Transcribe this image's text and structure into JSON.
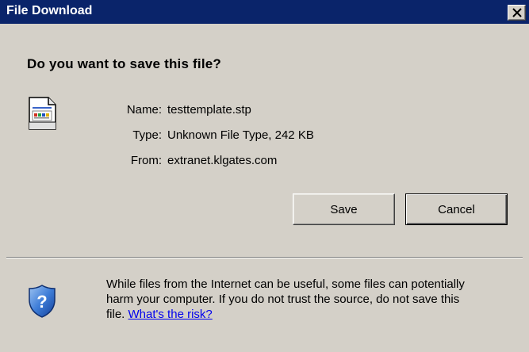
{
  "window": {
    "title": "File Download",
    "close_glyph": "×"
  },
  "dialog": {
    "question": "Do you want to save this file?",
    "file_icon": "document-icon",
    "fields": [
      {
        "label": "Name:",
        "value": "testtemplate.stp"
      },
      {
        "label": "Type:",
        "value": "Unknown File Type, 242 KB"
      },
      {
        "label": "From:",
        "value": "extranet.klgates.com"
      }
    ]
  },
  "buttons": {
    "save_label": "Save",
    "cancel_label": "Cancel"
  },
  "warning": {
    "icon": "shield-question-icon",
    "line1": "While files from the Internet can be useful, some files can potentially",
    "line2": "harm your computer. If you do not trust the source, do not save this",
    "line3_prefix": "file. ",
    "link_text": "What's the risk?"
  },
  "colors": {
    "titlebar": "#0a246a",
    "dialog_bg": "#d4d0c8",
    "link": "#0000ee"
  }
}
